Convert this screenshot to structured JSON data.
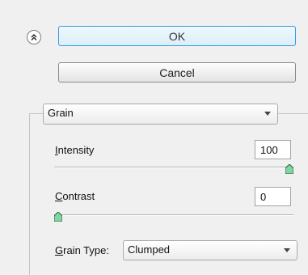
{
  "dialog": {
    "ok_label": "OK",
    "cancel_label": "Cancel"
  },
  "filter": {
    "selected": "Grain"
  },
  "controls": {
    "intensity": {
      "label_underlined": "I",
      "label_rest": "ntensity",
      "value": "100",
      "slider_fraction": 1.0
    },
    "contrast": {
      "label_underlined": "C",
      "label_rest": "ontrast",
      "value": "0",
      "slider_fraction": 0.0
    },
    "grain_type": {
      "label_underlined": "G",
      "label_rest": "rain Type:",
      "selected": "Clumped"
    }
  },
  "icons": {
    "collapse": "double-chevron-up-icon",
    "dropdown": "chevron-down-icon",
    "slider_thumb": "slider-thumb-icon"
  },
  "colors": {
    "ok_border": "#3c9ad9",
    "thumb_fill": "#7fd6a0"
  }
}
